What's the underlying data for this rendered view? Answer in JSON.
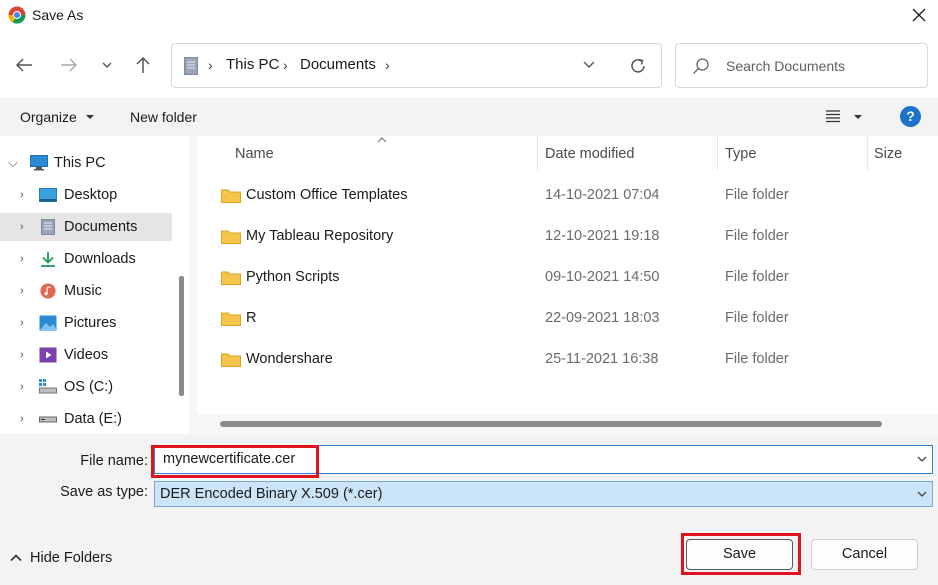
{
  "window": {
    "title": "Save As"
  },
  "nav": {
    "breadcrumb": [
      "This PC",
      "Documents"
    ],
    "search_placeholder": "Search Documents"
  },
  "toolbar": {
    "organize_label": "Organize",
    "new_folder_label": "New folder",
    "help_label": "?"
  },
  "sidebar": {
    "items": [
      {
        "label": "This PC",
        "icon": "monitor-icon",
        "expanded": true
      },
      {
        "label": "Desktop",
        "icon": "desktop-icon"
      },
      {
        "label": "Documents",
        "icon": "documents-icon",
        "selected": true
      },
      {
        "label": "Downloads",
        "icon": "download-icon"
      },
      {
        "label": "Music",
        "icon": "music-icon"
      },
      {
        "label": "Pictures",
        "icon": "pictures-icon"
      },
      {
        "label": "Videos",
        "icon": "videos-icon"
      },
      {
        "label": "OS (C:)",
        "icon": "drive-os-icon"
      },
      {
        "label": "Data (E:)",
        "icon": "drive-icon"
      }
    ]
  },
  "columns": {
    "name": "Name",
    "date": "Date modified",
    "type": "Type",
    "size": "Size"
  },
  "files": [
    {
      "name": "Custom Office Templates",
      "date": "14-10-2021 07:04",
      "type": "File folder"
    },
    {
      "name": "My Tableau Repository",
      "date": "12-10-2021 19:18",
      "type": "File folder"
    },
    {
      "name": "Python Scripts",
      "date": "09-10-2021 14:50",
      "type": "File folder"
    },
    {
      "name": "R",
      "date": "22-09-2021 18:03",
      "type": "File folder"
    },
    {
      "name": "Wondershare",
      "date": "25-11-2021 16:38",
      "type": "File folder"
    }
  ],
  "form": {
    "file_name_label": "File name:",
    "file_name_value": "mynewcertificate.cer",
    "save_type_label": "Save as type:",
    "save_type_value": "DER Encoded Binary X.509 (*.cer)"
  },
  "footer": {
    "hide_folders_label": "Hide Folders",
    "save_label": "Save",
    "cancel_label": "Cancel"
  },
  "colors": {
    "accent": "#1a73c8",
    "highlight": "#e0141e",
    "folder": "#f4c44b"
  }
}
